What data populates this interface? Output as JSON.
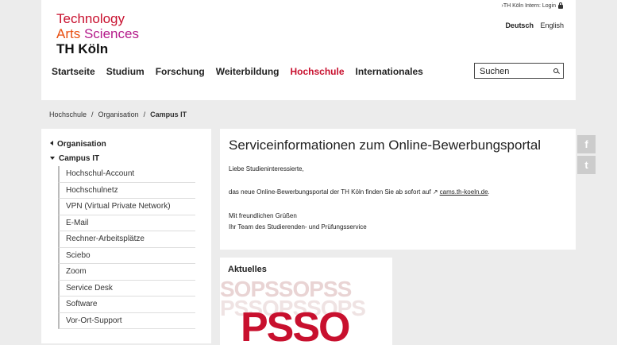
{
  "logo": {
    "line1": "Technology",
    "line2a": "Arts",
    "line2b": "Sciences",
    "line3": "TH Köln"
  },
  "header": {
    "intern": "›TH Köln Intern: Login",
    "lang_de": "Deutsch",
    "lang_en": "English"
  },
  "nav": [
    "Startseite",
    "Studium",
    "Forschung",
    "Weiterbildung",
    "Hochschule",
    "Internationales"
  ],
  "search": {
    "placeholder": "Suchen"
  },
  "breadcrumb": [
    "Hochschule",
    "Organisation",
    "Campus IT"
  ],
  "sidebar": {
    "parent": "Organisation",
    "current": "Campus IT",
    "items": [
      "Hochschul-Account",
      "Hochschulnetz",
      "VPN (Virtual Private Network)",
      "E-Mail",
      "Rechner-Arbeitsplätze",
      "Sciebo",
      "Zoom",
      "Service Desk",
      "Software",
      "Vor-Ort-Support"
    ]
  },
  "main": {
    "title": "Serviceinformationen zum Online-Bewerbungsportal",
    "greeting": "Liebe Studieninteressierte,",
    "body_prefix": "das neue Online-Bewerbungsportal der TH Köln finden Sie ab sofort auf",
    "link": "cams.th-koeln.de",
    "body_suffix": ".",
    "closing1": "Mit freundlichen Grüßen",
    "closing2": "Ihr Team des Studierenden- und Prüfungsservice"
  },
  "social": {
    "facebook": "f",
    "twitter": "t"
  },
  "news": {
    "title": "Aktuelles",
    "bg1": "SOPSSOPSS",
    "bg2": "PSSOPSSOPS",
    "logo": "PSSO"
  }
}
